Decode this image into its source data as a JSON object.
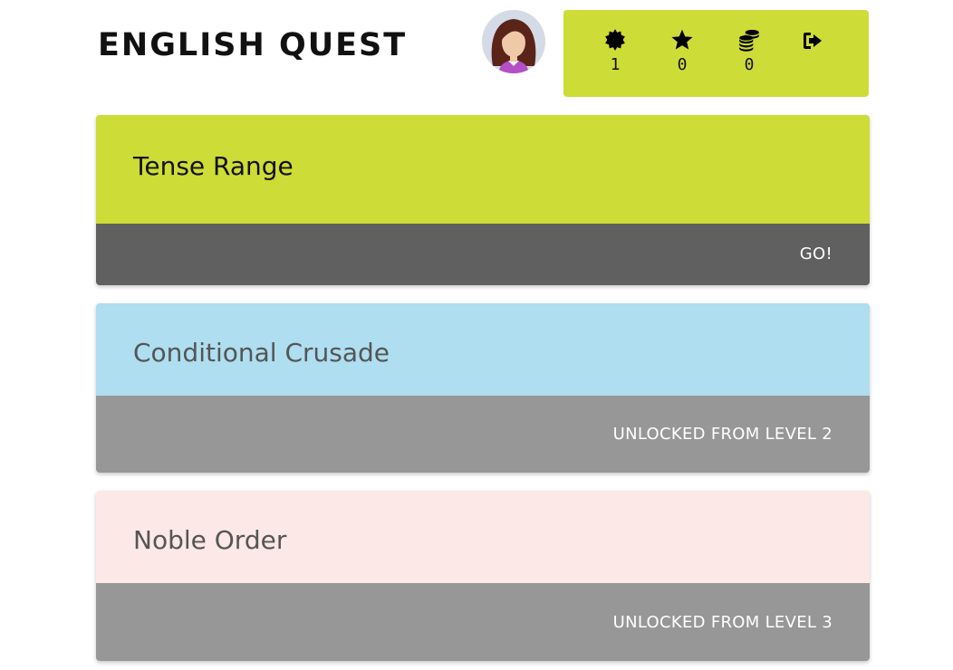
{
  "header": {
    "title": "ENGLISH QUEST",
    "avatar_icon": "avatar-girl-icon"
  },
  "stats": {
    "background": "#cddc37",
    "items": [
      {
        "icon": "badge-icon",
        "value": "1"
      },
      {
        "icon": "star-icon",
        "value": "0"
      },
      {
        "icon": "coins-icon",
        "value": "0"
      },
      {
        "icon": "logout-icon",
        "value": ""
      }
    ]
  },
  "levels": [
    {
      "title": "Tense Range",
      "action": "GO!",
      "top_color": "#cddc37",
      "bottom_color": "#606060",
      "title_color": "#111111"
    },
    {
      "title": "Conditional Crusade",
      "action": "UNLOCKED FROM LEVEL 2",
      "top_color": "#aedef0",
      "bottom_color": "#979797",
      "title_color": "#555555"
    },
    {
      "title": "Noble Order",
      "action": "UNLOCKED FROM LEVEL 3",
      "top_color": "#fde8e8",
      "bottom_color": "#979797",
      "title_color": "#555555"
    }
  ]
}
